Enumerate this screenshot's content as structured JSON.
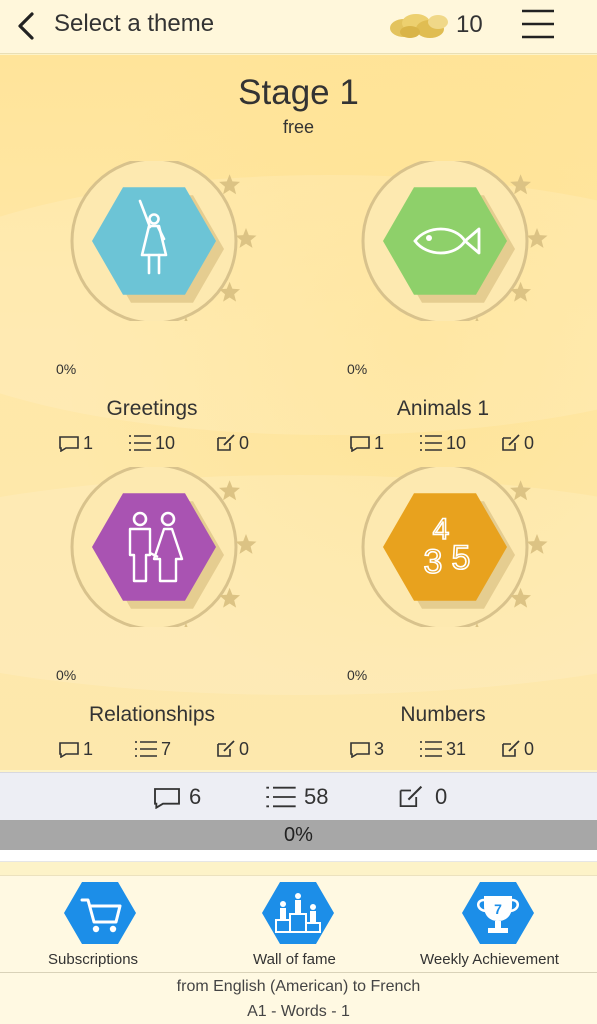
{
  "header": {
    "title": "Select a theme",
    "coins": "10",
    "back_icon": "chevron-left-icon",
    "coins_icon": "gold-coins-icon",
    "menu_icon": "hamburger-menu-icon"
  },
  "stage": {
    "title": "Stage 1",
    "subtitle": "free"
  },
  "themes": [
    {
      "name": "Greetings",
      "percent": "0%",
      "stars": 5,
      "color": "#6cc4d6",
      "icon": "waving-person-icon",
      "lessons": "1",
      "words": "10",
      "tests": "0"
    },
    {
      "name": "Animals 1",
      "percent": "0%",
      "stars": 5,
      "color": "#8ed06a",
      "icon": "fish-icon",
      "lessons": "1",
      "words": "10",
      "tests": "0"
    },
    {
      "name": "Relationships",
      "percent": "0%",
      "stars": 5,
      "color": "#a953b2",
      "icon": "couple-icon",
      "lessons": "1",
      "words": "7",
      "tests": "0"
    },
    {
      "name": "Numbers",
      "percent": "0%",
      "stars": 5,
      "color": "#e8a21e",
      "icon": "numbers-icon",
      "lessons": "3",
      "words": "31",
      "tests": "0"
    }
  ],
  "totals": {
    "lessons": "6",
    "words": "58",
    "tests": "0",
    "progress_label": "0%",
    "progress_value": 0
  },
  "nav": [
    {
      "label": "Subscriptions",
      "icon": "shopping-cart-icon"
    },
    {
      "label": "Wall of fame",
      "icon": "podium-icon"
    },
    {
      "label": "Weekly Achievement",
      "icon": "trophy-icon",
      "badge": "7"
    }
  ],
  "footer": {
    "line1": "from English (American) to French",
    "line2": "A1 - Words - 1"
  },
  "colors": {
    "accent_blue": "#1c8ee8",
    "star_gold": "#dcc384",
    "ring": "#d8c28c"
  }
}
